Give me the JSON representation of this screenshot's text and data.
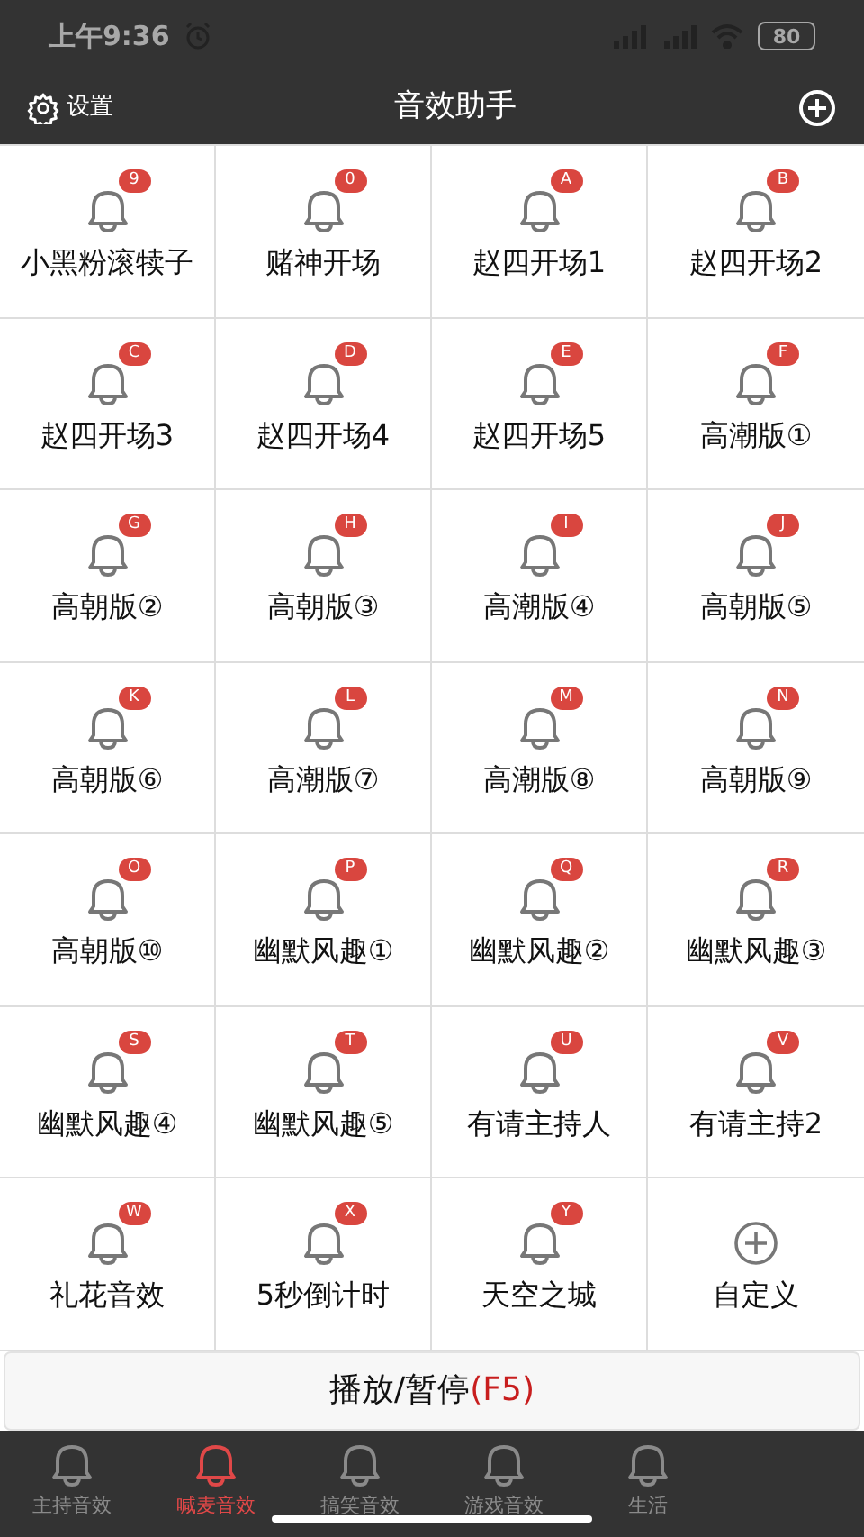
{
  "status_bar": {
    "time": "上午9:36",
    "battery": "80"
  },
  "header": {
    "settings_label": "设置",
    "title": "音效助手"
  },
  "sounds": [
    {
      "kind": "sound",
      "label": "小黑粉滚犊子",
      "key": "9"
    },
    {
      "kind": "sound",
      "label": "赌神开场",
      "key": "0"
    },
    {
      "kind": "sound",
      "label": "赵四开场1",
      "key": "A"
    },
    {
      "kind": "sound",
      "label": "赵四开场2",
      "key": "B"
    },
    {
      "kind": "sound",
      "label": "赵四开场3",
      "key": "C"
    },
    {
      "kind": "sound",
      "label": "赵四开场4",
      "key": "D"
    },
    {
      "kind": "sound",
      "label": "赵四开场5",
      "key": "E"
    },
    {
      "kind": "sound",
      "label": "高潮版①",
      "key": "F"
    },
    {
      "kind": "sound",
      "label": "高朝版②",
      "key": "G"
    },
    {
      "kind": "sound",
      "label": "高朝版③",
      "key": "H"
    },
    {
      "kind": "sound",
      "label": "高潮版④",
      "key": "I"
    },
    {
      "kind": "sound",
      "label": "高朝版⑤",
      "key": "J"
    },
    {
      "kind": "sound",
      "label": "高朝版⑥",
      "key": "K"
    },
    {
      "kind": "sound",
      "label": "高潮版⑦",
      "key": "L"
    },
    {
      "kind": "sound",
      "label": "高潮版⑧",
      "key": "M"
    },
    {
      "kind": "sound",
      "label": "高朝版⑨",
      "key": "N"
    },
    {
      "kind": "sound",
      "label": "高朝版⑩",
      "key": "O"
    },
    {
      "kind": "sound",
      "label": "幽默风趣①",
      "key": "P"
    },
    {
      "kind": "sound",
      "label": "幽默风趣②",
      "key": "Q"
    },
    {
      "kind": "sound",
      "label": "幽默风趣③",
      "key": "R"
    },
    {
      "kind": "sound",
      "label": "幽默风趣④",
      "key": "S"
    },
    {
      "kind": "sound",
      "label": "幽默风趣⑤",
      "key": "T"
    },
    {
      "kind": "sound",
      "label": "有请主持人",
      "key": "U"
    },
    {
      "kind": "sound",
      "label": "有请主持2",
      "key": "V"
    },
    {
      "kind": "sound",
      "label": "礼花音效",
      "key": "W"
    },
    {
      "kind": "sound",
      "label": "5秒倒计时",
      "key": "X"
    },
    {
      "kind": "sound",
      "label": "天空之城",
      "key": "Y"
    },
    {
      "kind": "add",
      "label": "自定义"
    }
  ],
  "play_button": {
    "label": "播放/暂停",
    "shortcut": "(F5)"
  },
  "tabs": [
    {
      "label": "主持音效",
      "selected": false
    },
    {
      "label": "喊麦音效",
      "selected": true
    },
    {
      "label": "搞笑音效",
      "selected": false
    },
    {
      "label": "游戏音效",
      "selected": false
    },
    {
      "label": "生活",
      "selected": false
    }
  ]
}
